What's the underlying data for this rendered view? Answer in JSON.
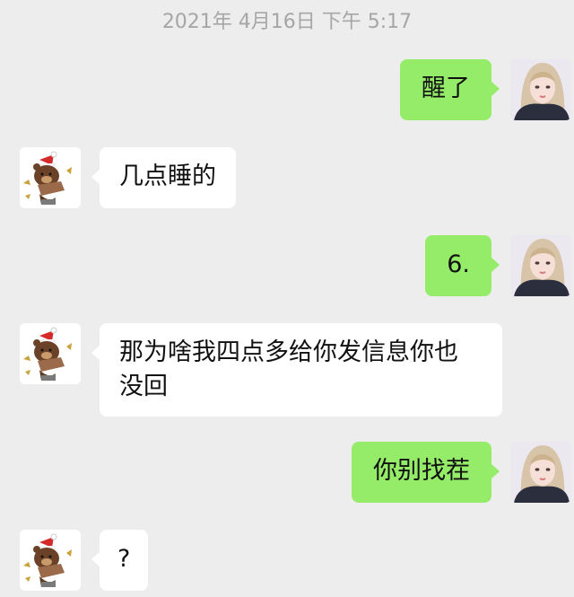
{
  "timestamp": "2021年 4月16日 下午 5:17",
  "colors": {
    "background": "#ededed",
    "outgoing_bubble": "#95ec69",
    "incoming_bubble": "#ffffff",
    "timestamp_text": "#a6a6a6"
  },
  "messages": [
    {
      "direction": "outgoing",
      "avatar": "girl-avatar",
      "text": "醒了"
    },
    {
      "direction": "incoming",
      "avatar": "brown-bear-santa-hat-avatar",
      "text": "几点睡的"
    },
    {
      "direction": "outgoing",
      "avatar": "girl-avatar",
      "text": "6."
    },
    {
      "direction": "incoming",
      "avatar": "brown-bear-santa-hat-avatar",
      "text_line1": "那为啥我四点多给你发信息你也",
      "text_line2": "没回"
    },
    {
      "direction": "outgoing",
      "avatar": "girl-avatar",
      "text": "你别找茬"
    },
    {
      "direction": "incoming",
      "avatar": "brown-bear-santa-hat-avatar",
      "text": "?"
    }
  ]
}
